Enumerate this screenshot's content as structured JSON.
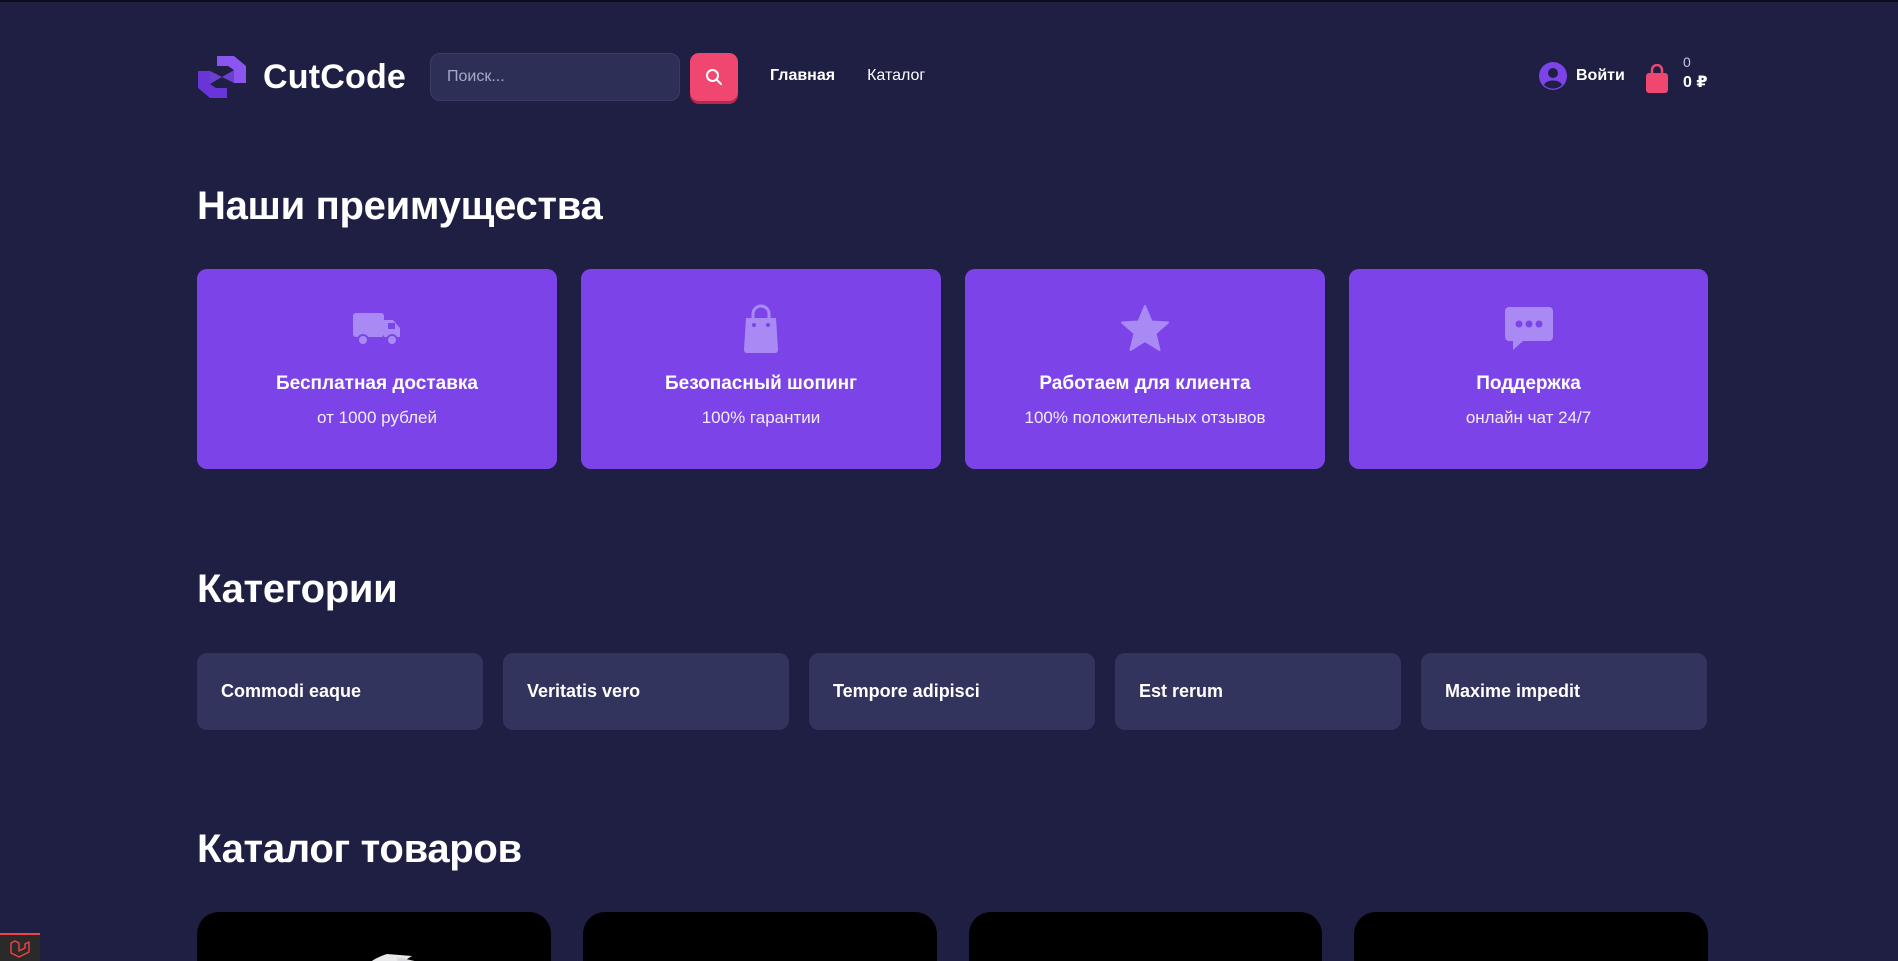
{
  "header": {
    "logo_text": "CutCode",
    "search": {
      "placeholder": "Поиск...",
      "value": ""
    },
    "nav": [
      {
        "label": "Главная",
        "active": true
      },
      {
        "label": "Каталог",
        "active": false
      }
    ],
    "login_label": "Войти",
    "cart": {
      "count": "0",
      "total": "0 ₽"
    }
  },
  "advantages": {
    "title": "Наши преимущества",
    "items": [
      {
        "icon": "truck-icon",
        "title": "Бесплатная доставка",
        "subtitle": "от 1000 рублей"
      },
      {
        "icon": "shopping-bag-icon",
        "title": "Безопасный шопинг",
        "subtitle": "100% гарантии"
      },
      {
        "icon": "star-icon",
        "title": "Работаем для клиента",
        "subtitle": "100% положительных отзывов"
      },
      {
        "icon": "chat-icon",
        "title": "Поддержка",
        "subtitle": "онлайн чат 24/7"
      }
    ]
  },
  "categories": {
    "title": "Категории",
    "items": [
      "Commodi eaque",
      "Veritatis vero",
      "Tempore adipisci",
      "Est rerum",
      "Maxime impedit"
    ]
  },
  "catalog": {
    "title": "Каталог товаров"
  },
  "colors": {
    "background": "#1e1f42",
    "accent_purple": "#7c44e8",
    "accent_pink": "#ef476f",
    "card_dark": "#33345e"
  }
}
